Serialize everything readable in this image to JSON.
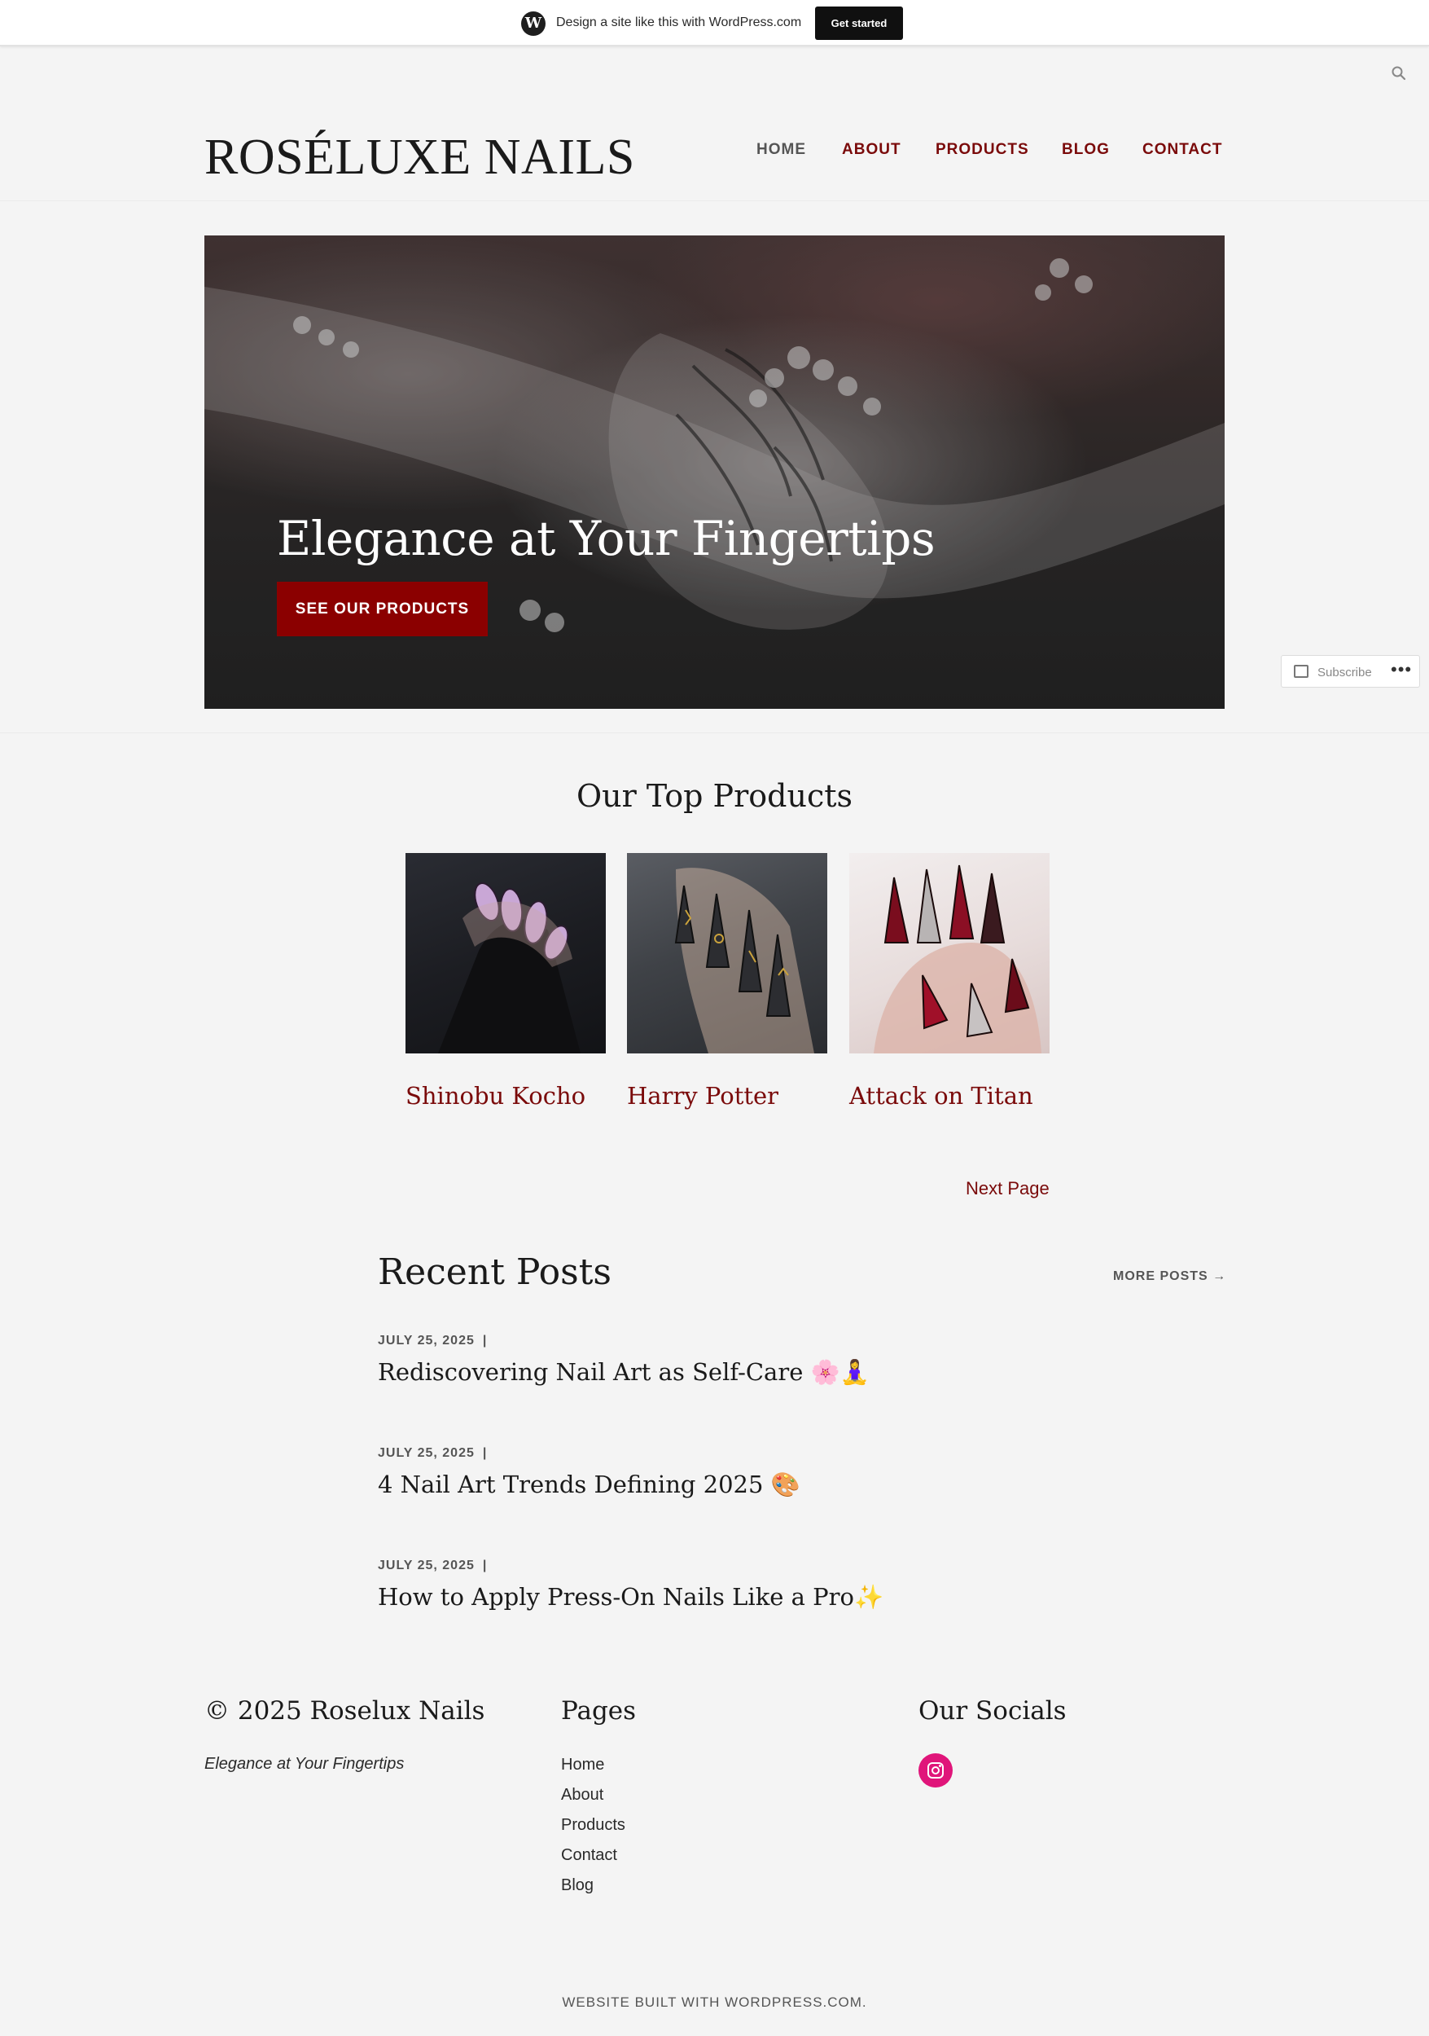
{
  "wpbar": {
    "text": "Design a site like this with WordPress.com",
    "button": "Get started"
  },
  "site": {
    "title": "ROSÉLUXE NAILS"
  },
  "nav": {
    "items": [
      {
        "label": "HOME",
        "current": true
      },
      {
        "label": "ABOUT",
        "current": false
      },
      {
        "label": "PRODUCTS",
        "current": false
      },
      {
        "label": "BLOG",
        "current": false
      },
      {
        "label": "CONTACT",
        "current": false
      }
    ]
  },
  "hero": {
    "title": "Elegance at Your Fingertips",
    "button": "SEE OUR PRODUCTS"
  },
  "subscribe": {
    "label": "Subscribe",
    "more": "•••"
  },
  "products": {
    "heading": "Our Top Products",
    "items": [
      {
        "name": "Shinobu Kocho"
      },
      {
        "name": "Harry Potter"
      },
      {
        "name": "Attack on Titan"
      }
    ],
    "next_page": "Next Page"
  },
  "recent_posts": {
    "heading": "Recent Posts",
    "more": "MORE POSTS →",
    "separator": "|",
    "posts": [
      {
        "date": "JULY 25, 2025",
        "title": "Rediscovering Nail Art as Self-Care 🌸🧘‍♀️"
      },
      {
        "date": "JULY 25, 2025",
        "title": "4 Nail Art Trends Defining 2025 🎨"
      },
      {
        "date": "JULY 25, 2025",
        "title": "How to Apply Press-On Nails Like a Pro✨"
      }
    ]
  },
  "footer": {
    "copyright": "© 2025 Roselux Nails",
    "tagline": "Elegance at Your Fingertips",
    "pages_heading": "Pages",
    "pages": [
      "Home",
      "About",
      "Products",
      "Contact",
      "Blog"
    ],
    "socials_heading": "Our Socials",
    "social_icon": "instagram-icon",
    "built_with": "WEBSITE BUILT WITH WORDPRESS.COM."
  },
  "colors": {
    "accent": "#7a0a0a",
    "button": "#8b0000",
    "instagram": "#e0157a",
    "background": "#f4f4f4"
  }
}
